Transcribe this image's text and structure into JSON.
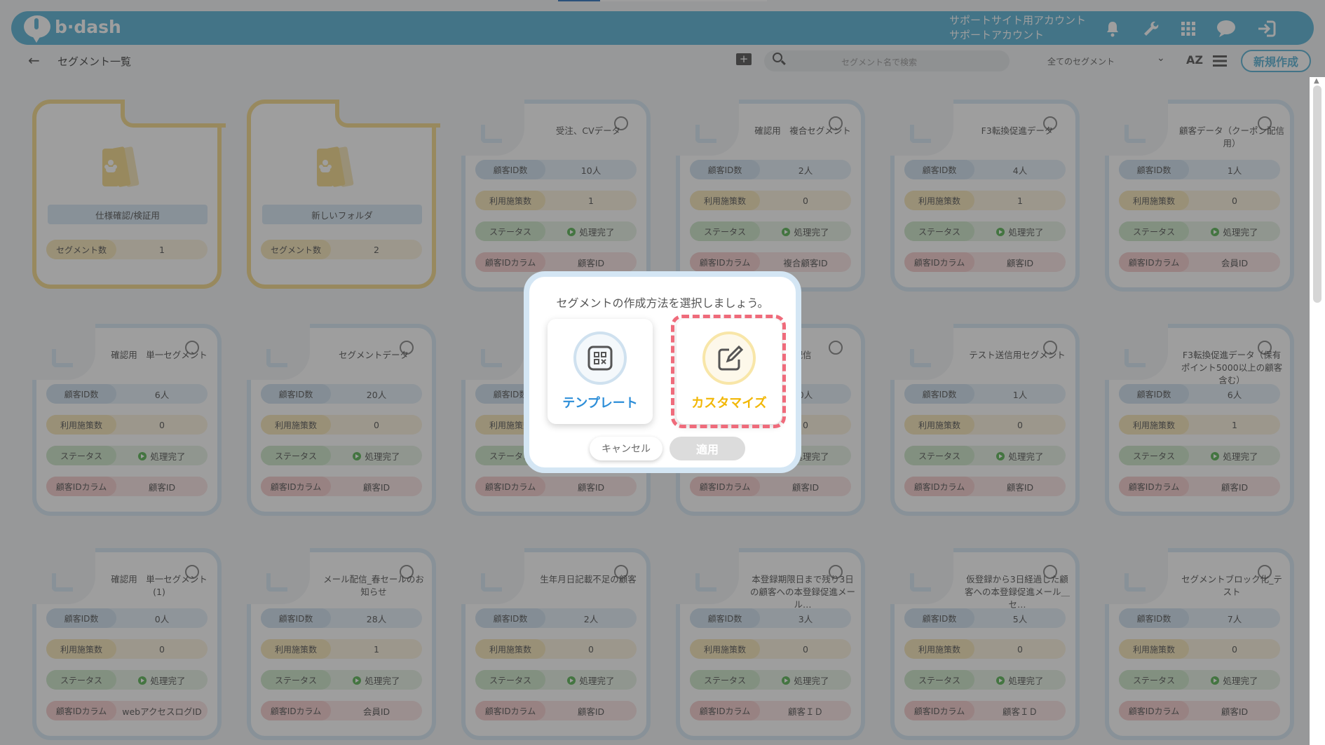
{
  "app": {
    "logo_text": "b·dash"
  },
  "header": {
    "account_line1": "サポートサイト用アカウント",
    "account_line2": "サポートアカウント"
  },
  "toolbar": {
    "title": "セグメント一覧",
    "search_placeholder": "セグメント名で検索",
    "filter_selected": "全てのセグメント",
    "sort_label": "AZ",
    "new_button": "新規作成"
  },
  "labels": {
    "segment_count": "セグメント数",
    "customer_count": "顧客ID数",
    "used_measures": "利用施策数",
    "status": "ステータス",
    "customer_column": "顧客IDカラム"
  },
  "folders": [
    {
      "name": "仕様確認/検証用",
      "count": "1"
    },
    {
      "name": "新しいフォルダ",
      "count": "2"
    }
  ],
  "segments": [
    {
      "title": "受注、CVデータ",
      "customers": "10人",
      "measures": "1",
      "status": "処理完了",
      "column": "顧客ID"
    },
    {
      "title": "確認用　複合セグメント",
      "customers": "2人",
      "measures": "0",
      "status": "処理完了",
      "column": "複合顧客ID"
    },
    {
      "title": "F3転換促進データ",
      "customers": "4人",
      "measures": "1",
      "status": "処理完了",
      "column": "顧客ID"
    },
    {
      "title": "顧客データ（クーポン配信用）",
      "customers": "1人",
      "measures": "0",
      "status": "処理完了",
      "column": "会員ID"
    },
    {
      "title": "確認用　単一セグメント",
      "customers": "6人",
      "measures": "0",
      "status": "処理完了",
      "column": "顧客ID"
    },
    {
      "title": "セグメントデータ",
      "customers": "20人",
      "measures": "0",
      "status": "処理完了",
      "column": "顧客ID"
    },
    {
      "title": "",
      "customers": "",
      "measures": "",
      "status": "",
      "column": "顧客ID"
    },
    {
      "title": "配信",
      "customers": "0人",
      "measures": "0",
      "status": "処理完了",
      "column": "顧客ID"
    },
    {
      "title": "テスト送信用セグメント",
      "customers": "1人",
      "measures": "0",
      "status": "処理完了",
      "column": "顧客ID"
    },
    {
      "title": "F3転換促進データ（保有ポイント5000以上の顧客含む）",
      "customers": "6人",
      "measures": "1",
      "status": "処理完了",
      "column": "顧客ID"
    },
    {
      "title": "確認用　単一セグメント (1)",
      "customers": "0人",
      "measures": "0",
      "status": "処理完了",
      "column": "webアクセスログID"
    },
    {
      "title": "メール配信_春セールのお知らせ",
      "customers": "28人",
      "measures": "1",
      "status": "処理完了",
      "column": "会員ID"
    },
    {
      "title": "生年月日記載不足の顧客",
      "customers": "2人",
      "measures": "0",
      "status": "処理完了",
      "column": "顧客ID"
    },
    {
      "title": "本登録期限日まで残り3日の顧客への本登録促進メール…",
      "customers": "3人",
      "measures": "0",
      "status": "処理完了",
      "column": "顧客ＩＤ"
    },
    {
      "title": "仮登録から3日経過した顧客への本登録促進メール＿セ…",
      "customers": "5人",
      "measures": "0",
      "status": "処理完了",
      "column": "顧客ＩＤ"
    },
    {
      "title": "セグメントブロック化_テスト",
      "customers": "7人",
      "measures": "0",
      "status": "処理完了",
      "column": "顧客ID"
    }
  ],
  "modal": {
    "title": "セグメントの作成方法を選択しましょう。",
    "option_template": "テンプレート",
    "option_custom": "カスタマイズ",
    "cancel": "キャンセル",
    "apply": "適用"
  },
  "colors": {
    "brand": "#5ab3d6",
    "template_accent": "#2d8ed8",
    "custom_accent": "#f2b705",
    "highlight": "#ef6b7b"
  }
}
